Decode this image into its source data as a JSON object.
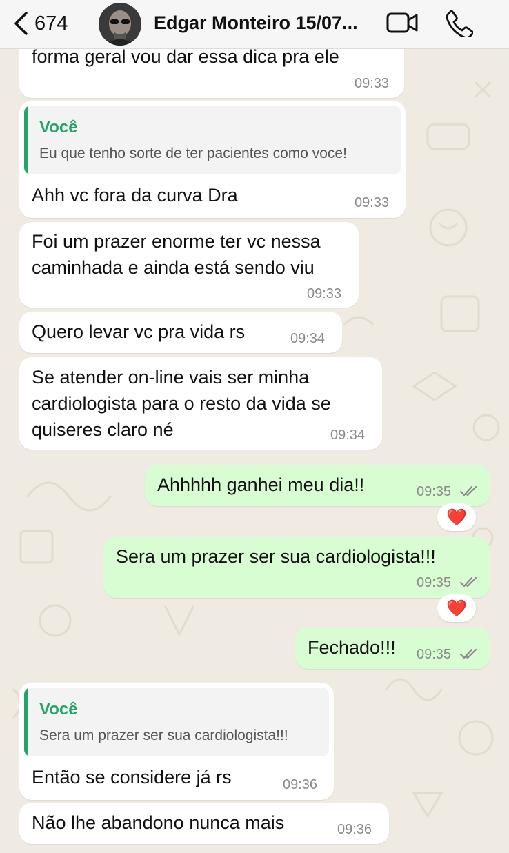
{
  "header": {
    "back_count": "674",
    "contact_name": "Edgar Monteiro 15/07..."
  },
  "messages": [
    {
      "text": "forma geral vou dar essa dica pra ele",
      "time": "09:33"
    },
    {
      "quote_author": "Você",
      "quote_text": "Eu que tenho sorte de ter pacientes como voce!",
      "text": "Ahh vc fora da curva Dra",
      "time": "09:33"
    },
    {
      "line1": "Foi um prazer enorme ter vc nessa",
      "line2": "caminhada e ainda está sendo viu",
      "time": "09:33"
    },
    {
      "text": "Quero levar vc pra vida rs",
      "time": "09:34"
    },
    {
      "line1": "Se atender on-line vais ser minha",
      "line2": "cardiologista para o resto da vida se",
      "line3": "quiseres claro né",
      "time": "09:34"
    },
    {
      "text": "Ahhhhh ganhei meu dia!!",
      "time": "09:35",
      "reaction": "❤️"
    },
    {
      "text": "Sera um prazer ser sua cardiologista!!!",
      "time": "09:35",
      "reaction": "❤️"
    },
    {
      "text": "Fechado!!!",
      "time": "09:35"
    },
    {
      "quote_author": "Você",
      "quote_text": "Sera um prazer ser sua cardiologista!!!",
      "text": "Então se considere já rs",
      "time": "09:36"
    },
    {
      "text": "Não lhe abandono nunca mais",
      "time": "09:36"
    }
  ],
  "colors": {
    "incoming": "#ffffff",
    "outgoing": "#d9fdd3",
    "background": "#efeae2",
    "quote_accent": "#25a26a",
    "read_ticks": "#8a8a8a",
    "heart": "#e0202e"
  }
}
